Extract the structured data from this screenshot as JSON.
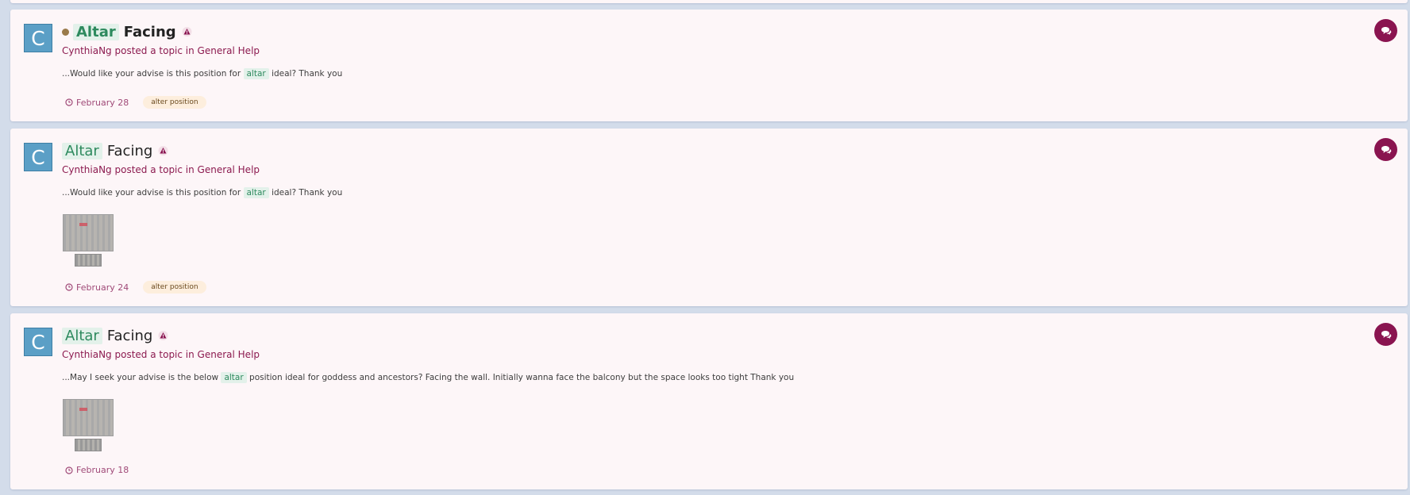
{
  "results": [
    {
      "avatar_letter": "C",
      "unread": true,
      "title_keyword": "Altar",
      "title_rest": "Facing",
      "byline": "CynthiaNg posted a topic in General Help",
      "snippet_before": "...Would like your advise is this position for",
      "snippet_keyword": "altar",
      "snippet_after": "ideal? Thank you",
      "has_thumbnail": false,
      "date": "February 28",
      "tag": "alter position"
    },
    {
      "avatar_letter": "C",
      "unread": false,
      "title_keyword": "Altar",
      "title_rest": "Facing",
      "byline": "CynthiaNg posted a topic in General Help",
      "snippet_before": "...Would like your advise is this position for",
      "snippet_keyword": "altar",
      "snippet_after": "ideal? Thank you",
      "has_thumbnail": true,
      "date": "February 24",
      "tag": "alter position"
    },
    {
      "avatar_letter": "C",
      "unread": false,
      "title_keyword": "Altar",
      "title_rest": "Facing",
      "byline": "CynthiaNg posted a topic in General Help",
      "snippet_before": "...May I seek your advise is the below",
      "snippet_keyword": "altar",
      "snippet_after": "position ideal for goddess and ancestors? Facing the wall. Initially wanna face the balcony but the space looks too tight Thank you",
      "has_thumbnail": true,
      "date": "February 18",
      "tag": ""
    }
  ],
  "icons": {
    "warning": "warning-triangle-icon",
    "clock": "clock-icon",
    "reply": "comments-icon"
  },
  "colors": {
    "page_bg": "#d3dcea",
    "card_bg": "#fdf6f8",
    "accent": "#8a1450",
    "highlight_bg": "#e3f1ea",
    "highlight_text": "#2e8a5e",
    "avatar_bg": "#5b9fc6",
    "tag_bg": "#fdeedd"
  }
}
